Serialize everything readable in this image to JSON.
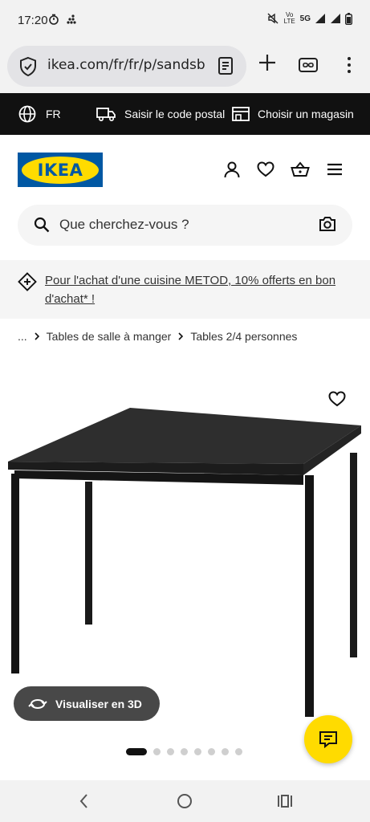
{
  "status": {
    "time": "17:20",
    "network": "5G",
    "volte": "Vo LTE"
  },
  "browser": {
    "url": "ikea.com/fr/fr/p/sandsb",
    "tab_count_icon": "infinity-tabs-icon"
  },
  "top_strip": {
    "language": "FR",
    "postal_code": "Saisir le code postal",
    "store": "Choisir un magasin"
  },
  "header": {
    "logo_text": "IKEA"
  },
  "search": {
    "placeholder": "Que cherchez-vous ?"
  },
  "promo": {
    "text": "Pour l'achat d'une cuisine METOD, 10% offerts en bon d'achat* !"
  },
  "breadcrumb": {
    "ellipsis": "...",
    "items": [
      "Tables de salle à manger",
      "Tables 2/4 personnes"
    ]
  },
  "product": {
    "visualize_label": "Visualiser en 3D",
    "image_count": 8,
    "active_image": 1
  },
  "colors": {
    "ikea_blue": "#0058a3",
    "ikea_yellow": "#ffdb00",
    "strip_black": "#111111"
  }
}
